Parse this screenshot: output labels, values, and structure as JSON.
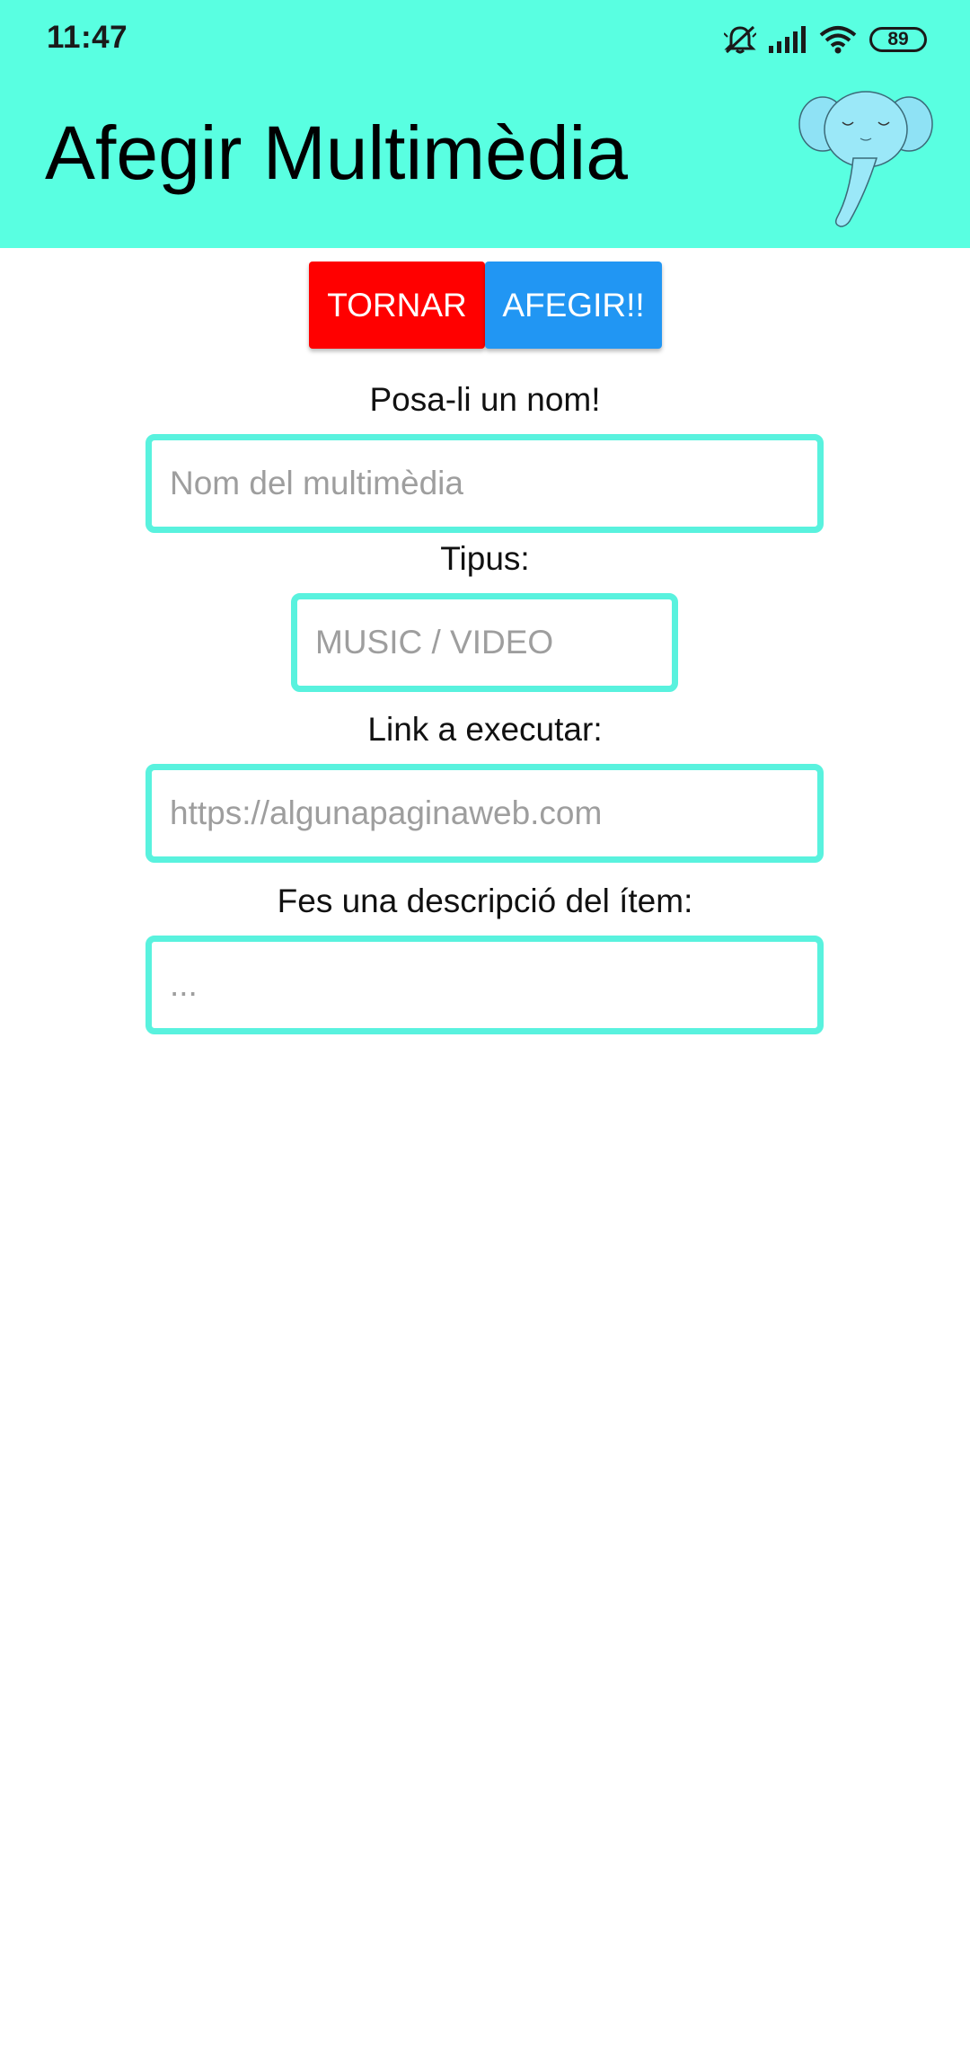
{
  "status_bar": {
    "time": "11:47",
    "battery": "89",
    "icons": [
      "mute-vibrate-icon",
      "signal-icon",
      "wifi-icon",
      "battery-icon"
    ]
  },
  "header": {
    "title": "Afegir Multimèdia",
    "background_color": "#59FFE1",
    "mascot": "elephant-logo"
  },
  "actions": {
    "back_label": "TORNAR",
    "back_color": "#FF0000",
    "add_label": "AFEGIR!!",
    "add_color": "#2196F3"
  },
  "form": {
    "name": {
      "label": "Posa-li un nom!",
      "value": "",
      "placeholder": "Nom del multimèdia"
    },
    "type": {
      "label": "Tipus:",
      "value": "",
      "placeholder": "MUSIC / VIDEO"
    },
    "link": {
      "label": "Link a executar:",
      "value": "",
      "placeholder": "https://algunapaginaweb.com"
    },
    "description": {
      "label": "Fes una descripció del ítem:",
      "value": "",
      "placeholder": "..."
    }
  }
}
